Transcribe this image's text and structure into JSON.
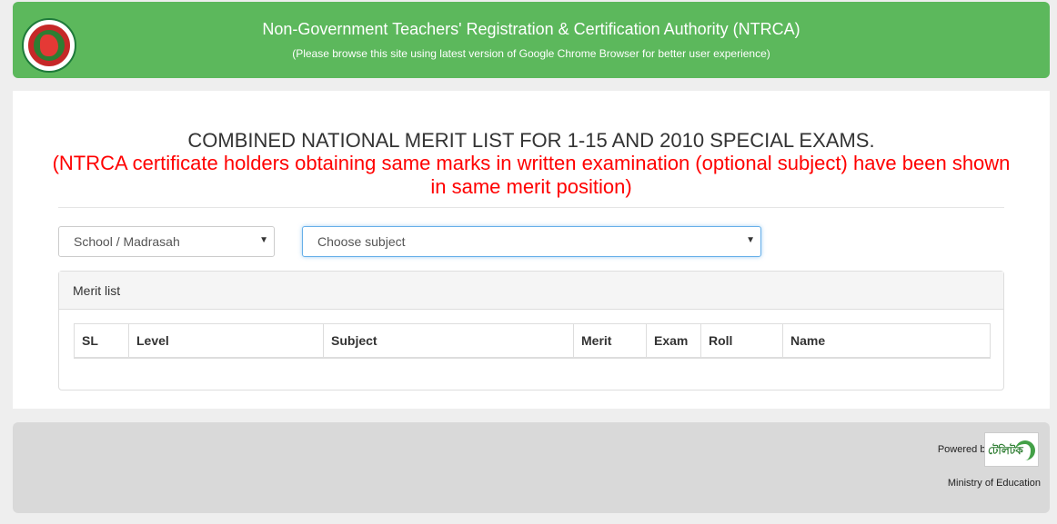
{
  "header": {
    "title": "Non-Government Teachers' Registration & Certification Authority (NTRCA)",
    "subtitle": "(Please browse this site using latest version of Google Chrome Browser for better user experience)"
  },
  "main": {
    "title": "COMBINED NATIONAL MERIT LIST FOR 1-15 AND 2010 SPECIAL EXAMS.",
    "subtitle": "(NTRCA certificate holders obtaining same marks in written examination (optional subject) have been shown in same merit position)"
  },
  "filters": {
    "type_selected": "School / Madrasah",
    "subject_selected": "Choose subject"
  },
  "panel": {
    "heading": "Merit list",
    "columns": [
      "SL",
      "Level",
      "Subject",
      "Merit",
      "Exam",
      "Roll",
      "Name"
    ]
  },
  "footer": {
    "powered_by": "Powered by:",
    "brand_logo_text": "টেলিটক",
    "ministry": "Ministry of Education"
  }
}
